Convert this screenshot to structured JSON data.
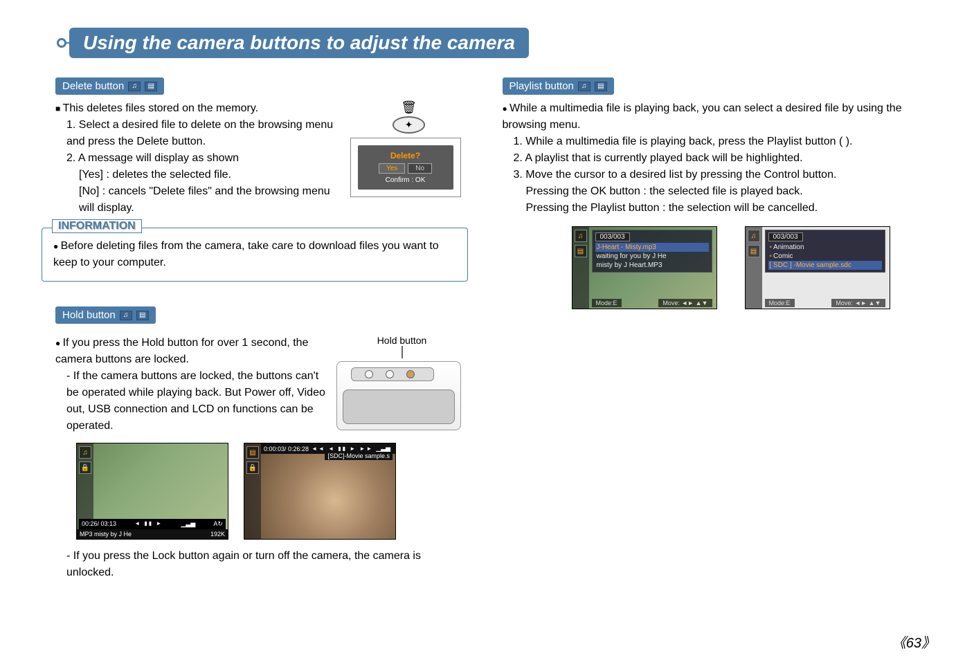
{
  "page_title": "Using the camera buttons to adjust the camera",
  "page_number": "《63》",
  "left": {
    "delete_section": {
      "header": "Delete  button",
      "intro": "This deletes files stored on the memory.",
      "step1": "1. Select a desired file to delete on the browsing menu and press the Delete button.",
      "step2": "2. A message will display as shown",
      "yes_line": "[Yes] : deletes the selected file.",
      "no_line": "[No]  : cancels \"Delete files\" and the browsing menu will display.",
      "dialog": {
        "title": "Delete?",
        "yes": "Yes",
        "no": "No",
        "confirm": "Confirm : OK"
      }
    },
    "information": {
      "title": "INFORMATION",
      "body": "Before deleting files from the camera, take care to download files you want to keep to your computer."
    },
    "hold_section": {
      "header": "Hold button",
      "callout": "Hold button",
      "intro": "If you press the Hold button for over 1 second, the camera buttons are locked.",
      "dash1": "- If the camera buttons are locked, the buttons can't be operated while playing back. But Power off, Video out, USB connection and LCD on functions can be operated.",
      "dash2": "- If you press the Lock button again or turn off the camera, the camera is unlocked.",
      "lcd1": {
        "time": "00:26/ 03:13",
        "label": "MP3   misty by J He",
        "rate": "192K",
        "syms": "◄ ▮▮ ►"
      },
      "lcd2": {
        "time": "0:00:03/ 0:26:28",
        "title": "[SDC]-Movie sample.s",
        "syms": "◄◄ ◄ ▮▮ ► ►►"
      }
    }
  },
  "right": {
    "playlist_section": {
      "header": "Playlist button",
      "intro": "While a multimedia file is playing back, you can select a desired file by using the browsing menu.",
      "step1": "1. While a multimedia file is playing back, press the Playlist button (          ).",
      "step2": "2. A playlist that is currently played back will be highlighted.",
      "step3": "3. Move the cursor to a desired list by pressing the Control button.",
      "ok_line": "Pressing the OK button : the selected file is played back.",
      "cancel_line": "Pressing the Playlist button : the selection will be cancelled.",
      "menu1": {
        "count": "003/003",
        "item1": "J-Heart - Misty.mp3",
        "item2": "waiting for you by J He",
        "item3": "misty by J Heart.MP3",
        "mode": "Mode:E",
        "move": "Move: ◄► ▲▼"
      },
      "menu2": {
        "count": "003/003",
        "item1": "Animation",
        "item2": "Comic",
        "item3": "[ SDC ] -Movie  sample.sdc",
        "mode": "Mode:E",
        "move": "Move: ◄► ▲▼"
      }
    }
  }
}
